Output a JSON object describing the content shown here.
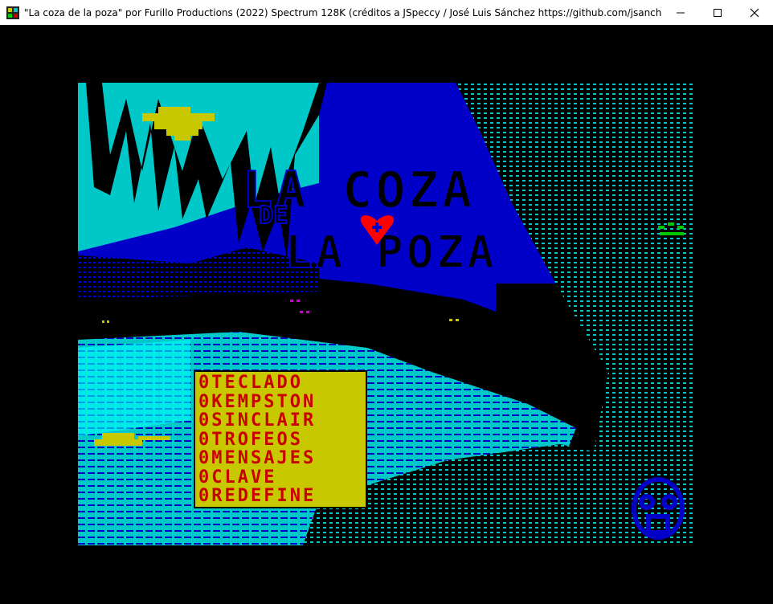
{
  "window": {
    "title": "\"La coza de la poza\" por Furillo Productions (2022) Spectrum 128K (créditos a JSpeccy / José Luis Sánchez https://github.com/jsanchezv/JSpeccy)",
    "controls": {
      "minimize_icon": "minimize-icon",
      "maximize_icon": "maximize-icon",
      "close_icon": "close-icon"
    }
  },
  "game": {
    "logo_lines": [
      "LA COZA",
      "DE",
      "LA POZA"
    ],
    "menu": [
      "0TECLADO",
      "0KEMPSTON",
      "0SINCLAIR",
      "0TROFEOS",
      "0MENSAJES",
      "0CLAVE",
      "0REDEFINE"
    ],
    "colors": {
      "sky": "#00c8c8",
      "night_blue": "#0000c8",
      "black": "#000000",
      "moon_yellow": "#c8c800",
      "menu_bg": "#c8c800",
      "menu_text": "#c80000",
      "heart_red": "#ff0000",
      "bright_cyan": "#00ffff",
      "green": "#00c800"
    }
  }
}
